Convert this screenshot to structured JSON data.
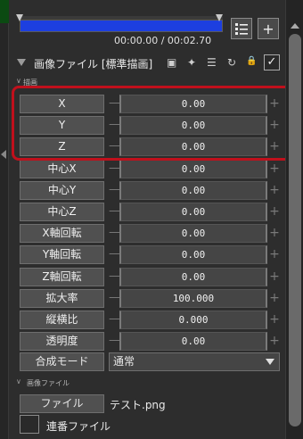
{
  "timeline": {
    "time": "00:00.00 / 00:02.70"
  },
  "toolbar": {
    "list_icon": "list-icon",
    "add_label": "+"
  },
  "object": {
    "title": "画像ファイル [標準描画]",
    "enabled": true
  },
  "sections": {
    "drawing": "描画",
    "image_file": "画像ファイル"
  },
  "params": [
    {
      "label": "X",
      "value": "0.00"
    },
    {
      "label": "Y",
      "value": "0.00"
    },
    {
      "label": "Z",
      "value": "0.00"
    },
    {
      "label": "中心X",
      "value": "0.00"
    },
    {
      "label": "中心Y",
      "value": "0.00"
    },
    {
      "label": "中心Z",
      "value": "0.00"
    },
    {
      "label": "X軸回転",
      "value": "0.00"
    },
    {
      "label": "Y軸回転",
      "value": "0.00"
    },
    {
      "label": "Z軸回転",
      "value": "0.00"
    },
    {
      "label": "拡大率",
      "value": "100.000"
    },
    {
      "label": "縦横比",
      "value": "0.000"
    },
    {
      "label": "透明度",
      "value": "0.00"
    }
  ],
  "blend": {
    "label": "合成モード",
    "value": "通常"
  },
  "file": {
    "button_label": "ファイル",
    "filename": "テスト.png"
  },
  "sequence": {
    "label": "連番ファイル",
    "checked": false
  },
  "colors": {
    "timeline_track": "#1d3fe0",
    "highlight_border": "#c0101c"
  }
}
